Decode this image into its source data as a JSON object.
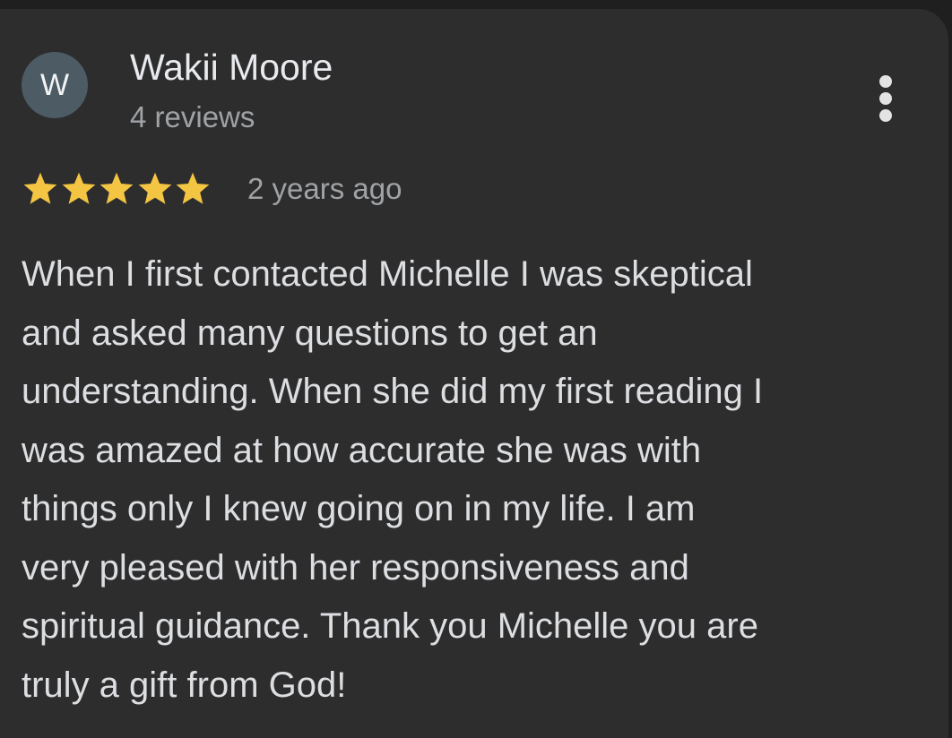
{
  "review": {
    "avatar_initial": "W",
    "author_name": "Wakii Moore",
    "author_reviews": "4 reviews",
    "rating": 5,
    "rating_max": 5,
    "time_ago": "2 years ago",
    "text_lines": [
      "When I first contacted Michelle I was skeptical",
      "and asked many questions to get an",
      "understanding. When she did my first reading I",
      "was amazed at how accurate she was with",
      "things only I knew going on in my life. I am",
      "very pleased with her responsiveness and",
      "spiritual guidance. Thank you Michelle you are",
      "truly a gift from God!"
    ],
    "menu_icon": "more-vert-icon",
    "star_icon": "star-icon"
  },
  "colors": {
    "page_background": "#1f1f1f",
    "card_background": "#2d2d2d",
    "star_filled": "#f4c542",
    "avatar_background": "#4c5b64"
  }
}
